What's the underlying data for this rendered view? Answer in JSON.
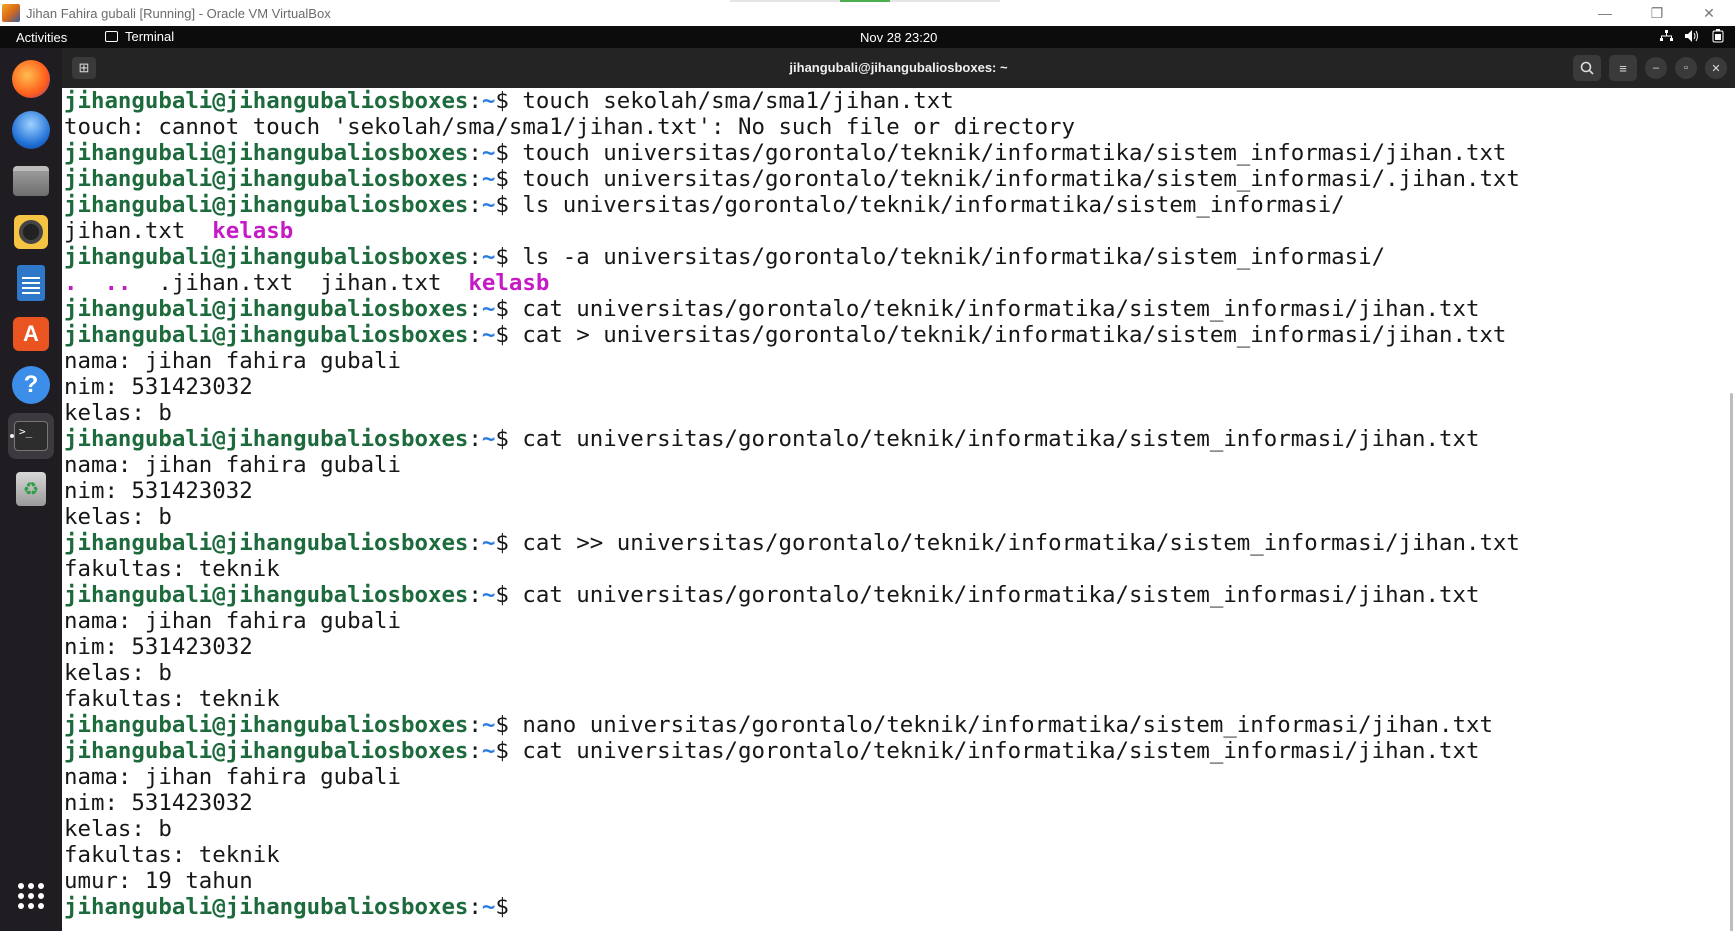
{
  "host": {
    "title": "Jihan Fahira gubali [Running] - Oracle VM VirtualBox",
    "minimize": "—",
    "restore": "❐",
    "close": "✕"
  },
  "topbar": {
    "activities": "Activities",
    "app_name": "Terminal",
    "clock": "Nov 28  23:20"
  },
  "dock": {
    "items": [
      "firefox-icon",
      "thunderbird-icon",
      "files-icon",
      "rhythmbox-icon",
      "writer-icon",
      "app-center-icon",
      "help-icon",
      "terminal-icon",
      "trash-icon",
      "show-apps-icon"
    ]
  },
  "terminal": {
    "title": "jihangubali@jihangubaliosboxes: ~",
    "new_tab_glyph": "⊞",
    "search_glyph": "⌕",
    "menu_glyph": "≡",
    "min_glyph": "–",
    "max_glyph": "▫",
    "close_glyph": "✕"
  },
  "prompt": {
    "user": "jihangubali@jihangubaliosboxes",
    "path": "~",
    "symbol": "$"
  },
  "lines": [
    {
      "type": "cmd",
      "text": " touch sekolah/sma/sma1/jihan.txt"
    },
    {
      "type": "out",
      "text": "touch: cannot touch 'sekolah/sma/sma1/jihan.txt': No such file or directory"
    },
    {
      "type": "cmd",
      "text": " touch universitas/gorontalo/teknik/informatika/sistem_informasi/jihan.txt"
    },
    {
      "type": "cmd",
      "text": " touch universitas/gorontalo/teknik/informatika/sistem_informasi/.jihan.txt"
    },
    {
      "type": "cmd",
      "text": " ls universitas/gorontalo/teknik/informatika/sistem_informasi/"
    },
    {
      "type": "ls1",
      "plain": "jihan.txt  ",
      "dir": "kelasb"
    },
    {
      "type": "cmd",
      "text": " ls -a universitas/gorontalo/teknik/informatika/sistem_informasi/"
    },
    {
      "type": "ls2",
      "dots": ".  ..",
      "plain": "  .jihan.txt  jihan.txt  ",
      "dir": "kelasb"
    },
    {
      "type": "cmd",
      "text": " cat universitas/gorontalo/teknik/informatika/sistem_informasi/jihan.txt"
    },
    {
      "type": "cmd",
      "text": " cat > universitas/gorontalo/teknik/informatika/sistem_informasi/jihan.txt"
    },
    {
      "type": "out",
      "text": "nama: jihan fahira gubali"
    },
    {
      "type": "out",
      "text": "nim: 531423032"
    },
    {
      "type": "out",
      "text": "kelas: b"
    },
    {
      "type": "cmd",
      "text": " cat universitas/gorontalo/teknik/informatika/sistem_informasi/jihan.txt"
    },
    {
      "type": "out",
      "text": "nama: jihan fahira gubali"
    },
    {
      "type": "out",
      "text": "nim: 531423032"
    },
    {
      "type": "out",
      "text": "kelas: b"
    },
    {
      "type": "cmd",
      "text": " cat >> universitas/gorontalo/teknik/informatika/sistem_informasi/jihan.txt"
    },
    {
      "type": "out",
      "text": "fakultas: teknik"
    },
    {
      "type": "cmd",
      "text": " cat universitas/gorontalo/teknik/informatika/sistem_informasi/jihan.txt"
    },
    {
      "type": "out",
      "text": "nama: jihan fahira gubali"
    },
    {
      "type": "out",
      "text": "nim: 531423032"
    },
    {
      "type": "out",
      "text": "kelas: b"
    },
    {
      "type": "out",
      "text": "fakultas: teknik"
    },
    {
      "type": "cmd",
      "text": " nano universitas/gorontalo/teknik/informatika/sistem_informasi/jihan.txt"
    },
    {
      "type": "cmd",
      "text": " cat universitas/gorontalo/teknik/informatika/sistem_informasi/jihan.txt"
    },
    {
      "type": "out",
      "text": "nama: jihan fahira gubali"
    },
    {
      "type": "out",
      "text": "nim: 531423032"
    },
    {
      "type": "out",
      "text": "kelas: b"
    },
    {
      "type": "out",
      "text": "fakultas: teknik"
    },
    {
      "type": "out",
      "text": "umur: 19 tahun"
    },
    {
      "type": "cmd",
      "text": " "
    }
  ],
  "colors": {
    "prompt_user": "#1d6b3d",
    "prompt_path": "#2a7bde",
    "directory": "#c61ac6",
    "terminal_bg": "#ffffff",
    "header_bg": "#242424",
    "dock_bg": "#1f1c22"
  }
}
